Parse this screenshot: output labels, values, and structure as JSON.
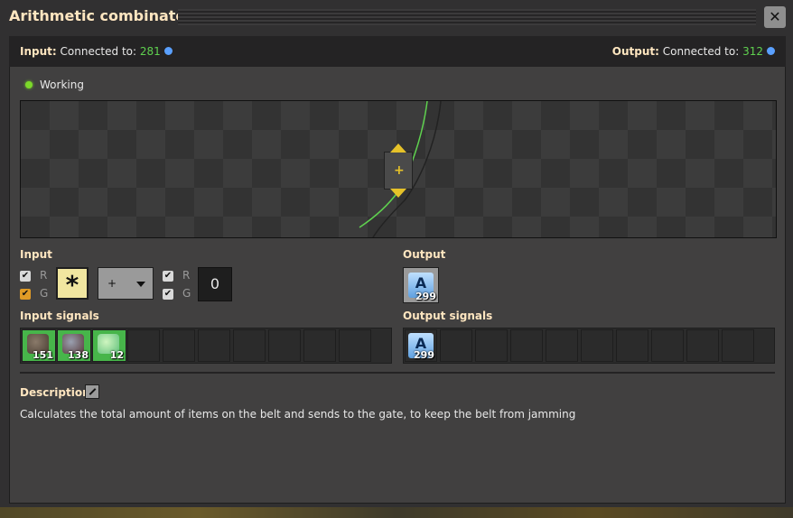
{
  "window": {
    "title": "Arithmetic combinator",
    "close_icon": "close-icon"
  },
  "connections": {
    "input_label": "Input:",
    "input_text": "Connected to:",
    "input_value": "281",
    "output_label": "Output:",
    "output_text": "Connected to:",
    "output_value": "312"
  },
  "status": {
    "text": "Working",
    "color": "#7cd92a"
  },
  "config": {
    "input_label": "Input",
    "output_label": "Output",
    "left_checks": [
      {
        "label": "R",
        "checked": true
      },
      {
        "label": "G",
        "checked": true
      }
    ],
    "right_checks": [
      {
        "label": "R",
        "checked": true
      },
      {
        "label": "G",
        "checked": true
      }
    ],
    "left_signal": "*",
    "operation": "+",
    "constant": "0",
    "output_signal": "A",
    "output_count": "299"
  },
  "signals": {
    "input_label": "Input signals",
    "output_label": "Output signals",
    "input": [
      {
        "icon": "stone-icon",
        "count": "151"
      },
      {
        "icon": "iron-ore-icon",
        "count": "138"
      },
      {
        "icon": "uranium-ore-icon",
        "count": "12"
      }
    ],
    "output": [
      {
        "icon": "A",
        "count": "299"
      }
    ]
  },
  "description": {
    "label": "Description",
    "text": "Calculates the total amount of items on the belt and sends to the gate, to keep the belt from jamming"
  }
}
